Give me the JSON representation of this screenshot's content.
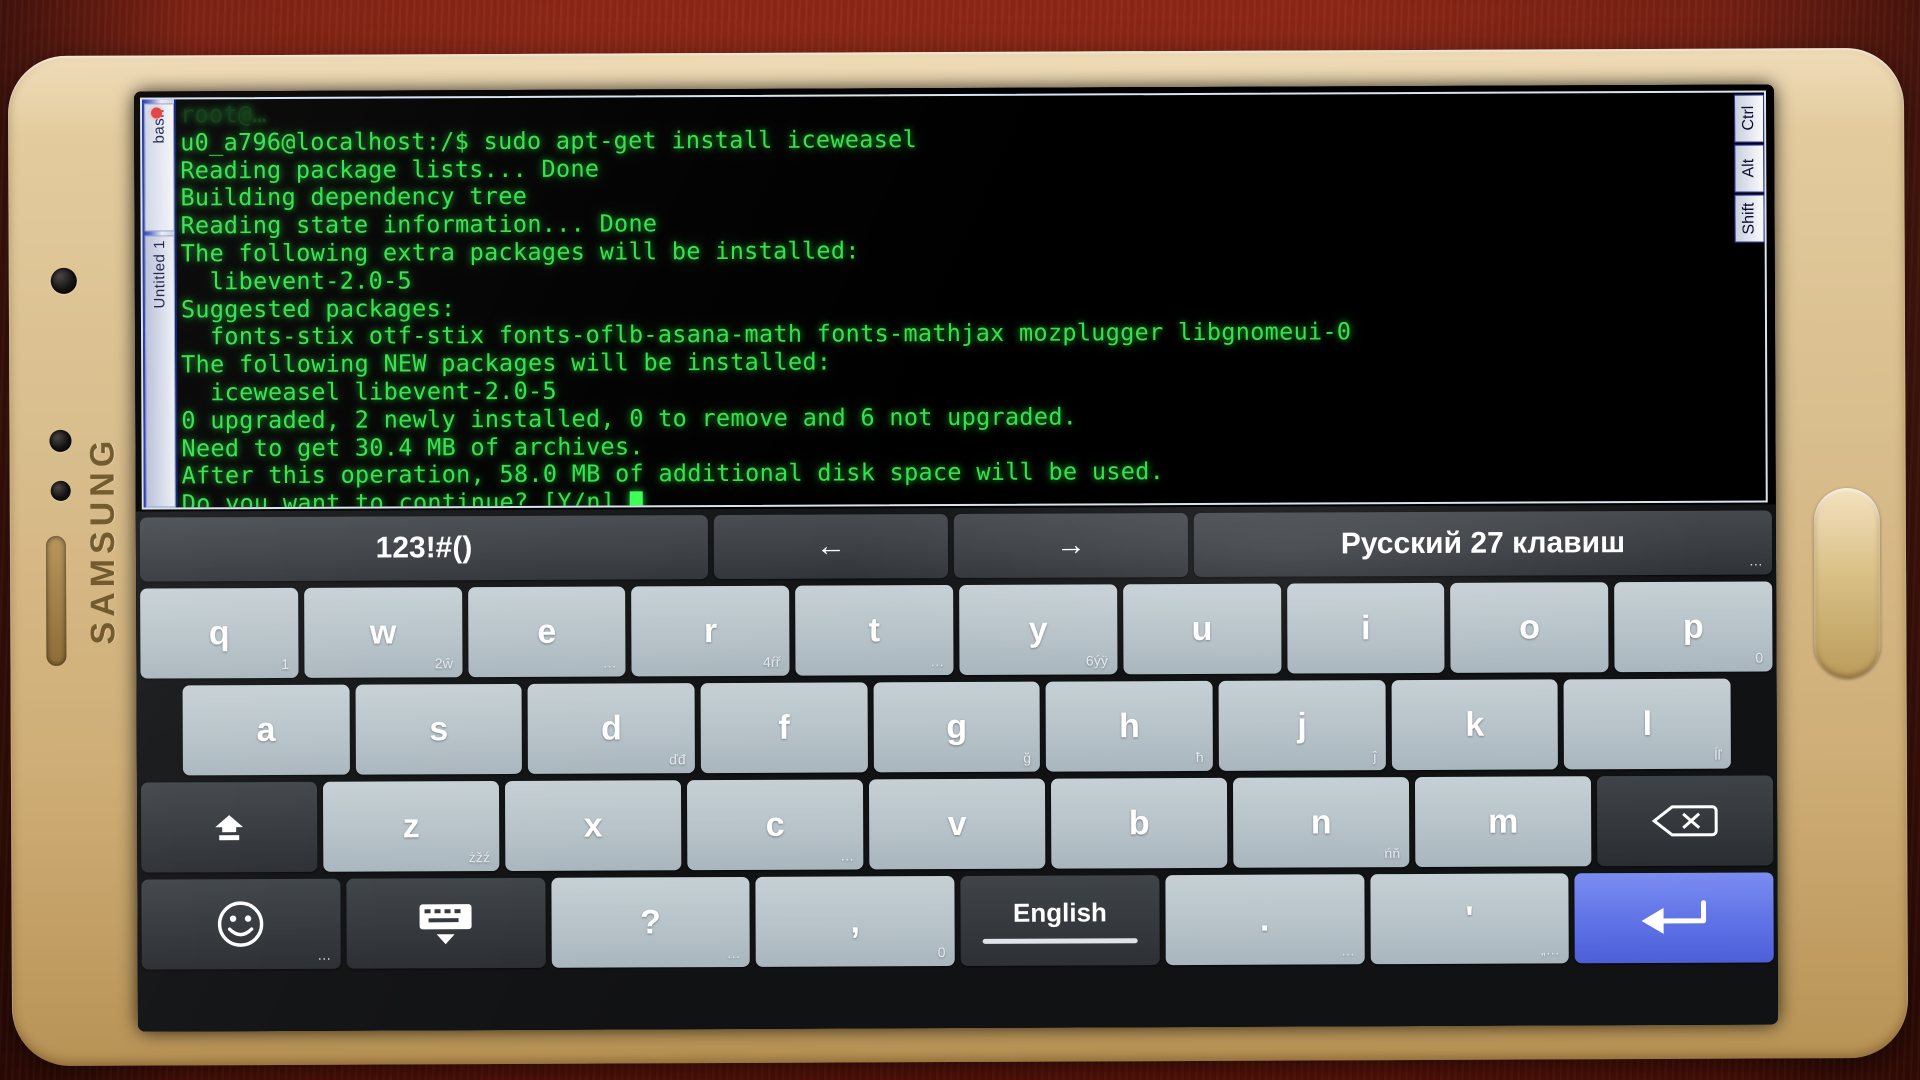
{
  "device": {
    "brand": "SAMSUNG"
  },
  "terminal": {
    "tabs": [
      {
        "label": "bash",
        "has_indicator": true
      },
      {
        "label": "Untitled 1",
        "has_indicator": false
      }
    ],
    "modifier_keys": [
      "Ctrl",
      "Alt",
      "Shift"
    ],
    "lines": [
      {
        "text": "u0_a796@localhost:/$ sudo apt-get install iceweasel"
      },
      {
        "text": "Reading package lists... Done"
      },
      {
        "text": "Building dependency tree"
      },
      {
        "text": "Reading state information... Done"
      },
      {
        "text": "The following extra packages will be installed:"
      },
      {
        "text": "  libevent-2.0-5"
      },
      {
        "text": "Suggested packages:"
      },
      {
        "text": "  fonts-stix otf-stix fonts-oflb-asana-math fonts-mathjax mozplugger libgnomeui-0"
      },
      {
        "text": "The following NEW packages will be installed:"
      },
      {
        "text": "  iceweasel libevent-2.0-5"
      },
      {
        "text": "0 upgraded, 2 newly installed, 0 to remove and 6 not upgraded."
      },
      {
        "text": "Need to get 30.4 MB of archives."
      },
      {
        "text": "After this operation, 58.0 MB of additional disk space will be used."
      },
      {
        "text": "Do you want to continue? [Y/n] "
      }
    ],
    "colors": {
      "text": "#31e44a",
      "background": "#000000",
      "border": "#d8e3ef"
    }
  },
  "keyboard": {
    "row1": [
      {
        "id": "symbols",
        "label": "123!#()",
        "sub": ""
      },
      {
        "id": "arrow-left",
        "label": "←",
        "sub": ""
      },
      {
        "id": "arrow-right",
        "label": "→",
        "sub": ""
      },
      {
        "id": "layout",
        "label": "Русский 27 клавиш",
        "sub": "…"
      }
    ],
    "row2": [
      {
        "label": "q",
        "sub": "1"
      },
      {
        "label": "w",
        "sub": "2ŵ"
      },
      {
        "label": "e",
        "sub": "…"
      },
      {
        "label": "r",
        "sub": "4ŕř"
      },
      {
        "label": "t",
        "sub": "…"
      },
      {
        "label": "y",
        "sub": "6ýÿ"
      },
      {
        "label": "u",
        "sub": ""
      },
      {
        "label": "i",
        "sub": ""
      },
      {
        "label": "o",
        "sub": ""
      },
      {
        "label": "p",
        "sub": "0"
      }
    ],
    "row3": [
      {
        "label": "a",
        "sub": ""
      },
      {
        "label": "s",
        "sub": ""
      },
      {
        "label": "d",
        "sub": "ďđ"
      },
      {
        "label": "f",
        "sub": ""
      },
      {
        "label": "g",
        "sub": "ğ"
      },
      {
        "label": "h",
        "sub": "ħ"
      },
      {
        "label": "j",
        "sub": "ĵ"
      },
      {
        "label": "k",
        "sub": ""
      },
      {
        "label": "l",
        "sub": "ĺľ"
      }
    ],
    "row4": [
      {
        "id": "shift",
        "label": "shift-icon",
        "sub": ""
      },
      {
        "label": "z",
        "sub": "żžź"
      },
      {
        "label": "x",
        "sub": ""
      },
      {
        "label": "c",
        "sub": "…"
      },
      {
        "label": "v",
        "sub": ""
      },
      {
        "label": "b",
        "sub": ""
      },
      {
        "label": "n",
        "sub": "ńň"
      },
      {
        "label": "m",
        "sub": ""
      },
      {
        "id": "backspace",
        "label": "backspace-icon",
        "sub": ""
      }
    ],
    "row5": [
      {
        "id": "emoji",
        "label": "emoji-icon",
        "sub": "…"
      },
      {
        "id": "hide-keyboard",
        "label": "hide-keyboard-icon",
        "sub": ""
      },
      {
        "label": "?",
        "sub": "…"
      },
      {
        "label": ",",
        "sub": "0"
      },
      {
        "id": "space",
        "label": "English",
        "sub": ""
      },
      {
        "label": ".",
        "sub": "…"
      },
      {
        "label": "'",
        "sub": "„…"
      },
      {
        "id": "enter",
        "label": "enter-icon",
        "sub": ""
      }
    ]
  },
  "colors": {
    "accent_enter": "#5f72e6",
    "key_letter": "#b7c3c9",
    "key_dark": "#34383d",
    "terminal_green": "#31e44a",
    "desk": "#8d2616",
    "phone_body": "#d8bd8c"
  }
}
